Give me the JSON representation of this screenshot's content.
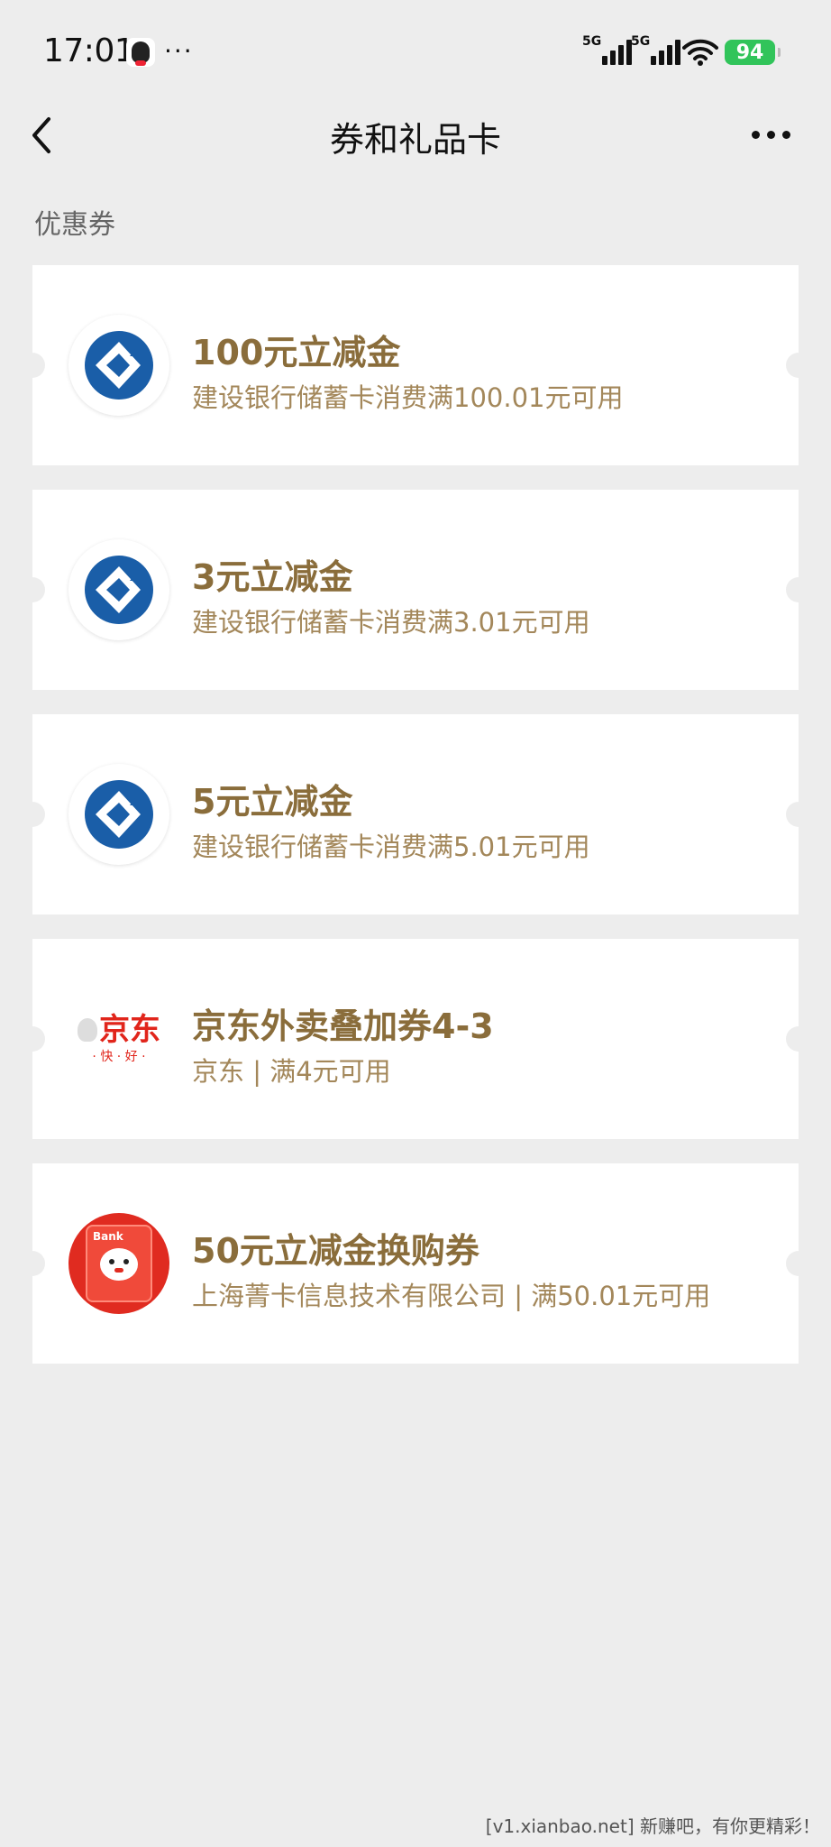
{
  "status_bar": {
    "time": "17:01",
    "dots": "···",
    "signal1_label": "5G",
    "signal2_label": "5G",
    "battery": "94"
  },
  "nav": {
    "title": "券和礼品卡"
  },
  "section_title": "优惠券",
  "coupons": [
    {
      "title": "100元立减金",
      "subtitle": "建设银行储蓄卡消费满100.01元可用",
      "logo": "ccb-logo"
    },
    {
      "title": "3元立减金",
      "subtitle": "建设银行储蓄卡消费满3.01元可用",
      "logo": "ccb-logo"
    },
    {
      "title": "5元立减金",
      "subtitle": "建设银行储蓄卡消费满5.01元可用",
      "logo": "ccb-logo"
    },
    {
      "title": "京东外卖叠加券4-3",
      "subtitle": "京东 | 满4元可用",
      "logo": "jd-logo",
      "logo_text": "京东",
      "logo_sub": "· 快 · 好 ·"
    },
    {
      "title": "50元立减金换购券",
      "subtitle": "上海菁卡信息技术有限公司 | 满50.01元可用",
      "logo": "bank-card-logo",
      "logo_text": "Bank"
    }
  ],
  "watermark": "[v1.xianbao.net] 新赚吧，有你更精彩！",
  "colors": {
    "background": "#ededed",
    "coupon_title": "#8a6d3b",
    "coupon_sub": "#a3875a",
    "ccb_blue": "#1a5ea8",
    "jd_red": "#e1251b"
  }
}
